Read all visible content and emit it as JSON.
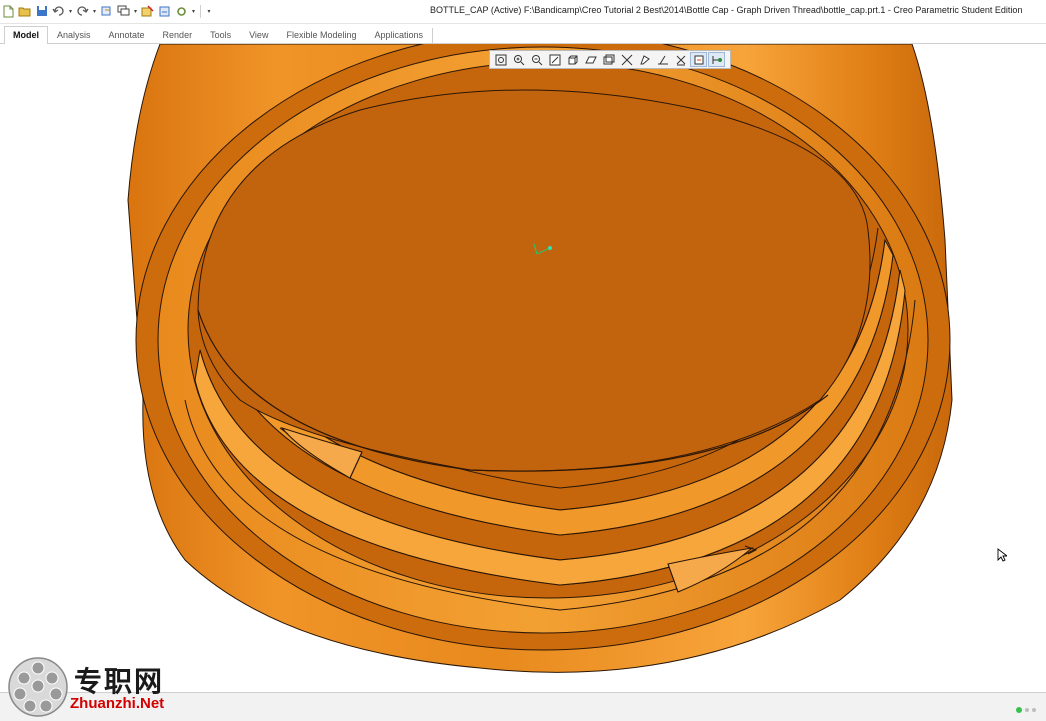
{
  "window": {
    "title": "BOTTLE_CAP (Active) F:\\Bandicamp\\Creo Tutorial 2 Best\\2014\\Bottle Cap - Graph Driven Thread\\bottle_cap.prt.1 - Creo Parametric Student Edition"
  },
  "quick_access": [
    {
      "icon": "new-file-icon"
    },
    {
      "icon": "open-folder-icon"
    },
    {
      "icon": "save-icon"
    },
    {
      "icon": "undo-icon"
    },
    {
      "icon": "redo-icon"
    },
    {
      "icon": "regenerate-icon"
    },
    {
      "icon": "windows-icon"
    },
    {
      "icon": "close-window-icon"
    },
    {
      "icon": "customize-icon"
    }
  ],
  "ribbon": {
    "tabs": [
      "Model",
      "Analysis",
      "Annotate",
      "Render",
      "Tools",
      "View",
      "Flexible Modeling",
      "Applications"
    ],
    "active_tab": "Model"
  },
  "graphics_toolbar": [
    {
      "icon": "refit-icon"
    },
    {
      "icon": "zoom-in-icon"
    },
    {
      "icon": "zoom-out-icon"
    },
    {
      "icon": "repaint-icon"
    },
    {
      "icon": "display-style-icon"
    },
    {
      "icon": "saved-orientations-icon"
    },
    {
      "icon": "view-manager-icon"
    },
    {
      "icon": "datum-display-icon"
    },
    {
      "icon": "annotation-display-icon"
    },
    {
      "icon": "spin-center-icon"
    },
    {
      "icon": "plane-tag-icon"
    },
    {
      "icon": "appearance-icon"
    },
    {
      "icon": "point-display-icon"
    }
  ],
  "model": {
    "name": "bottle_cap",
    "color_base": "#c2630e",
    "color_light": "#f39a2a",
    "color_dark": "#9a4a06",
    "edge_color": "#2a1606"
  },
  "watermark": {
    "cn": "专职网",
    "en": "Zhuanzhi.Net"
  }
}
